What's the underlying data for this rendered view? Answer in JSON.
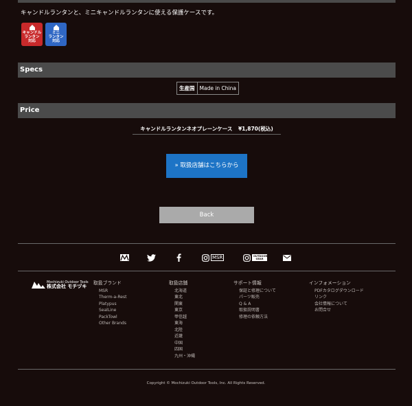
{
  "intro": "キャンドルランタンと、ミニキャンドルランタンに使える保護ケースです。",
  "badges": {
    "candle": {
      "line1": "キャンドル",
      "line2": "ランタン",
      "line3": "対応"
    },
    "mini": {
      "line1": "ミニ",
      "line2": "ランタン",
      "line3": "対応"
    }
  },
  "specs": {
    "heading": "Specs",
    "label": "生産国",
    "value": "Made in China"
  },
  "price": {
    "heading": "Price",
    "item": "キャンドルランタンネオプレーンケース",
    "amount": "¥1,870",
    "tax": "(税込)"
  },
  "buttons": {
    "shops": "» 取扱店舗はこちらから",
    "back": "Back"
  },
  "social": {
    "instagram_msr": "MSR",
    "instagram_gear": "OUTDOOR GEAR"
  },
  "logo": {
    "line1": "Mochizuki Outdoor Tools",
    "line2": "株式会社 モチヅキ"
  },
  "footer": {
    "brands": {
      "heading": "取扱ブランド",
      "items": [
        "MSR",
        "Therm-a-Rest",
        "Platypus",
        "SealLine",
        "PackTowl",
        "Other Brands"
      ]
    },
    "stores": {
      "heading": "取扱店舗",
      "items": [
        "北海道",
        "東北",
        "関東",
        "東京",
        "甲信越",
        "東海",
        "北陸",
        "近畿",
        "中国",
        "四国",
        "九州・沖縄"
      ]
    },
    "support": {
      "heading": "サポート情報",
      "items": [
        "保証と修理について",
        "パーツ販売",
        "Q & A",
        "取扱説明書",
        "修理の依頼方法"
      ]
    },
    "info": {
      "heading": "インフォメーション",
      "items": [
        "PDFカタログダウンロード",
        "リンク",
        "会社情報について",
        "お問合せ"
      ]
    }
  },
  "copyright": "Copyright © Mochizuki Outdoor Tools, Inc. All Rights Reserved.",
  "colors": {
    "background": "#170c0b",
    "section_bar": "#4b4b4b",
    "shop_button": "#1d74c6",
    "back_button": "#aaaaaa",
    "badge_red": "#c82a2b",
    "badge_blue": "#2f67c4"
  }
}
